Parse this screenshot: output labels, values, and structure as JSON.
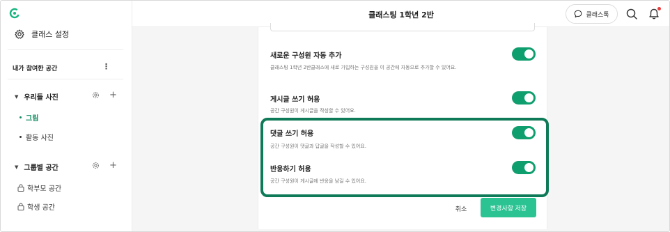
{
  "sidebar": {
    "settings_label": "클래스 설정",
    "my_spaces_title": "내가 참여한 공간",
    "groups": [
      {
        "label": "우리들 사진",
        "items": [
          {
            "label": "그림",
            "active": true
          },
          {
            "label": "활동 사진",
            "active": false
          }
        ]
      },
      {
        "label": "그룹별 공간"
      }
    ],
    "locked_spaces": [
      {
        "label": "학부모 공간"
      },
      {
        "label": "학생 공간"
      }
    ]
  },
  "header": {
    "title": "클래스팅 1학년 2반",
    "talk_label": "클래스톡"
  },
  "options": [
    {
      "title": "새로운 구성원 자동 추가",
      "desc": "클래스팅 1학년 2반클래스에 새로 가입하는 구성원을 이 공간에 자동으로 추가할 수 있어요.",
      "enabled": true
    },
    {
      "title": "게시글 쓰기 허용",
      "desc": "공간 구성원이 게시글을 작성할 수 있어요.",
      "enabled": true
    },
    {
      "title": "댓글 쓰기 허용",
      "desc": "공간 구성원이 댓글과 답글을 작성할 수 있어요.",
      "enabled": true
    },
    {
      "title": "반응하기 허용",
      "desc": "공간 구성원이 게시글에 반응을 남길 수 있어요.",
      "enabled": true
    }
  ],
  "actions": {
    "cancel_label": "취소",
    "save_label": "변경사항 저장"
  },
  "colors": {
    "accent": "#0f9e6e",
    "highlight": "#0e7a57",
    "save_button": "#2cc393"
  }
}
